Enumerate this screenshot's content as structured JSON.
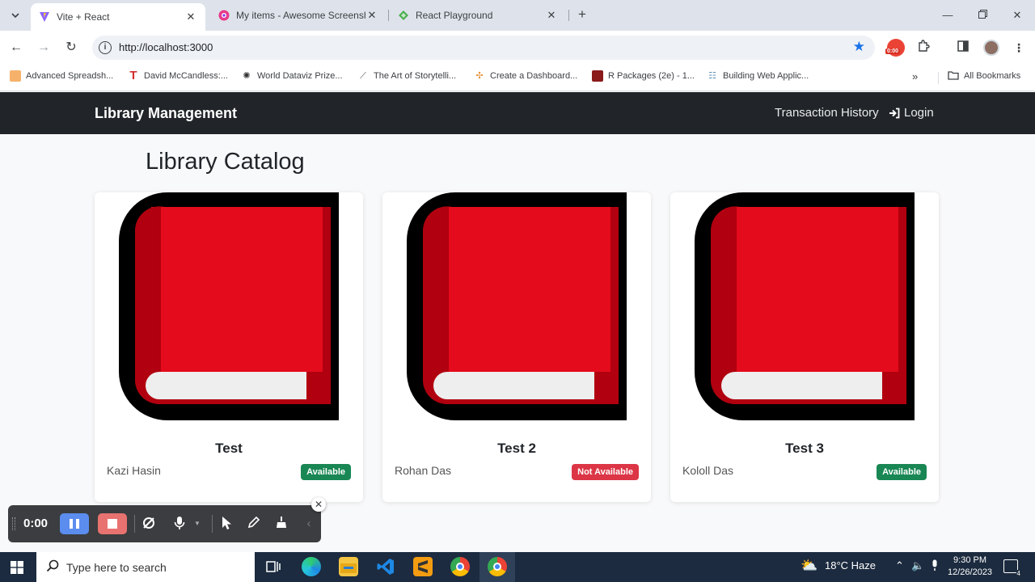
{
  "browser": {
    "tabs": [
      {
        "title": "Vite + React",
        "active": true
      },
      {
        "title": "My items - Awesome Screensh",
        "active": false
      },
      {
        "title": "React Playground",
        "active": false
      }
    ],
    "url": "http://localhost:3000",
    "bookmarks": [
      "Advanced Spreadsh...",
      "David McCandless:...",
      "World Dataviz Prize...",
      "The Art of Storytelli...",
      "Create a Dashboard...",
      "R Packages (2e) - 1...",
      "Building Web Applic..."
    ],
    "all_bookmarks": "All Bookmarks",
    "extension_timer": "0:00"
  },
  "app": {
    "brand": "Library Management",
    "nav": {
      "transaction_history": "Transaction History",
      "login": "Login"
    },
    "page_title": "Library Catalog",
    "books": [
      {
        "title": "Test",
        "author": "Kazi Hasin",
        "status": "Available",
        "status_color": "#198754"
      },
      {
        "title": "Test 2",
        "author": "Rohan Das",
        "status": "Not Available",
        "status_color": "#dc3545"
      },
      {
        "title": "Test 3",
        "author": "Kololl Das",
        "status": "Available",
        "status_color": "#198754"
      }
    ]
  },
  "recorder": {
    "time": "0:00"
  },
  "taskbar": {
    "search_placeholder": "Type here to search",
    "weather": "18°C  Haze",
    "time": "9:30 PM",
    "date": "12/26/2023",
    "notification_count": "4"
  },
  "colors": {
    "nav_bg": "#212529",
    "book_red": "#e30b1c",
    "accent_blue": "#1a73e8"
  }
}
